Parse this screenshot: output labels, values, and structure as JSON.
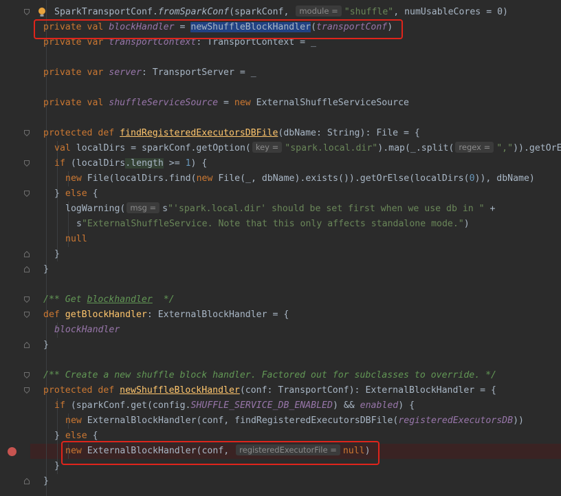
{
  "hints": {
    "module": "module =",
    "key": "key =",
    "regex": "regex =",
    "msg": "msg =",
    "registered": "registeredExecutorFile ="
  },
  "lines": {
    "l1": {
      "head": "SparkTransportConf.",
      "method": "fromSparkConf",
      "args": "(sparkConf, ",
      "str": "\"shuffle\"",
      "tail": ", numUsableCores = 0)"
    },
    "l2": {
      "kw": "private val ",
      "fld": "blockHandler",
      "eq": " = ",
      "call": "newShuffleBlockHandler",
      "open": "(",
      "arg": "transportConf",
      "close": ")"
    },
    "l3": {
      "kw": "private var ",
      "fld": "transportContext",
      "rest": ": TransportContext = _"
    },
    "l4": {
      "kw": "private var ",
      "fld": "server",
      "rest": ": TransportServer = _"
    },
    "l5": {
      "kw": "private val ",
      "fld": "shuffleServiceSource",
      "eq": " = ",
      "kw2": "new ",
      "rest": "ExternalShuffleServiceSource"
    },
    "l6": {
      "kw": "protected def ",
      "fn": "findRegisteredExecutorsDBFile",
      "rest": "(dbName: String): File = {"
    },
    "l7": {
      "kw": "val ",
      "rest": "localDirs = sparkConf.getOption(",
      "str": "\"spark.local.dir\"",
      "mid": ").map(_.split(",
      "str2": "\",\"",
      "tail": ")).getOrE"
    },
    "l8": {
      "kw": "if ",
      "a": "(localDirs",
      "b": ".length",
      "c": " >= ",
      "num": "1",
      "d": ") {"
    },
    "l9": {
      "kw": "new ",
      "a": "File(localDirs.find(",
      "kw2": "new ",
      "b": "File(_, dbName).exists()).getOrElse(localDirs(",
      "num": "0",
      "c": ")), dbName)"
    },
    "l10": {
      "a": "} ",
      "kw": "else",
      "b": " {"
    },
    "l11": {
      "a": "logWarning(",
      "s": "s",
      "str": "\"'spark.local.dir' should be set first when we use db in \"",
      "b": " +"
    },
    "l12": {
      "s": "s",
      "str": "\"ExternalShuffleService. Note that this only affects standalone mode.\"",
      "b": ")"
    },
    "l13": {
      "kw": "null"
    },
    "l14": {
      "a": "}"
    },
    "l15": {
      "a": "}"
    },
    "l16": {
      "a": "/** Get ",
      "b": "blockhandler",
      "c": "  */"
    },
    "l17": {
      "kw": "def ",
      "fn": "getBlockHandler",
      "rest": ": ExternalBlockHandler = {"
    },
    "l18": {
      "fld": "blockHandler"
    },
    "l19": {
      "a": "}"
    },
    "l20": {
      "a": "/** Create a new shuffle block handler. Factored out for subclasses to override. */"
    },
    "l21": {
      "kw": "protected def ",
      "fn": "newShuffleBlockHandler",
      "rest": "(conf: TransportConf): ExternalBlockHandler = {"
    },
    "l22": {
      "kw": "if ",
      "a": "(sparkConf.get(config.",
      "const": "SHUFFLE_SERVICE_DB_ENABLED",
      "b": ") && ",
      "fld": "enabled",
      "c": ") {"
    },
    "l23": {
      "kw": "new ",
      "a": "ExternalBlockHandler(conf, findRegisteredExecutorsDBFile(",
      "fld": "registeredExecutorsDB",
      "b": "))"
    },
    "l24": {
      "a": "} ",
      "kw": "else",
      "b": " {"
    },
    "l25": {
      "kw": "new ",
      "a": "ExternalBlockHandler(conf, ",
      "kw2": "null",
      "b": ")"
    },
    "l26": {
      "a": "}"
    },
    "l27": {
      "a": "}"
    }
  },
  "colors": {
    "background": "#2b2b2b",
    "keyword": "#cc7832",
    "field": "#9876aa",
    "function": "#ffc66d",
    "string": "#6a8759",
    "number": "#6897bb",
    "comment": "#629755",
    "highlight_box": "#e0241b",
    "breakpoint": "#c75450"
  },
  "icons": {
    "gutter": [
      "fold-icon",
      "breakpoint-icon",
      "intention-bulb-icon"
    ]
  }
}
